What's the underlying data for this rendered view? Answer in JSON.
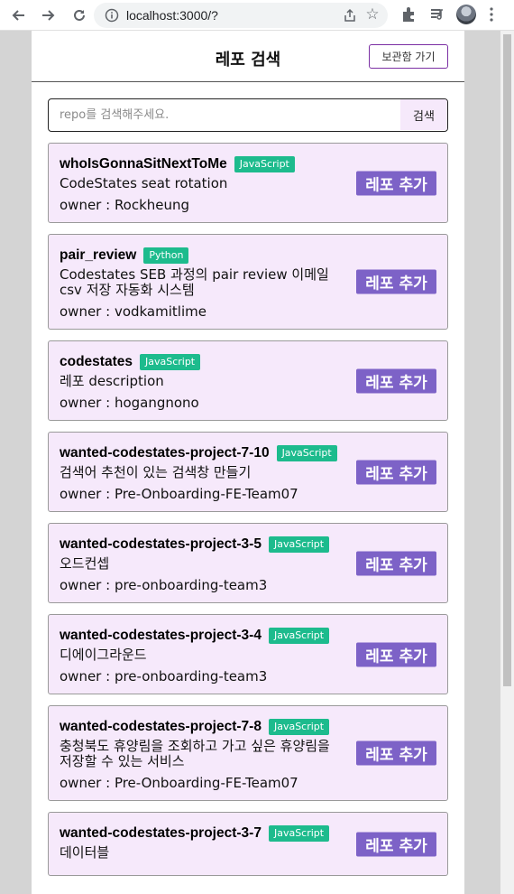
{
  "browser": {
    "url": "localhost:3000/?"
  },
  "header": {
    "title": "레포 검색",
    "box_button": "보관함 가기"
  },
  "search": {
    "placeholder": "repo를 검색해주세요.",
    "button": "검색"
  },
  "repos": [
    {
      "name": "whoIsGonnaSitNextToMe",
      "language": "JavaScript",
      "description": "CodeStates seat rotation",
      "owner": "owner : Rockheung",
      "add_label": "레포 추가"
    },
    {
      "name": "pair_review",
      "language": "Python",
      "description": "Codestates SEB 과정의 pair review 이메일 csv 저장 자동화 시스템",
      "owner": "owner : vodkamitlime",
      "add_label": "레포 추가"
    },
    {
      "name": "codestates",
      "language": "JavaScript",
      "description": "레포 description",
      "owner": "owner : hogangnono",
      "add_label": "레포 추가"
    },
    {
      "name": "wanted-codestates-project-7-10",
      "language": "JavaScript",
      "description": "검색어 추천이 있는 검색창 만들기",
      "owner": "owner : Pre-Onboarding-FE-Team07",
      "add_label": "레포 추가"
    },
    {
      "name": "wanted-codestates-project-3-5",
      "language": "JavaScript",
      "description": "오드컨셉",
      "owner": "owner : pre-onboarding-team3",
      "add_label": "레포 추가"
    },
    {
      "name": "wanted-codestates-project-3-4",
      "language": "JavaScript",
      "description": "디에이그라운드",
      "owner": "owner : pre-onboarding-team3",
      "add_label": "레포 추가"
    },
    {
      "name": "wanted-codestates-project-7-8",
      "language": "JavaScript",
      "description": "충청북도 휴양림을 조회하고 가고 싶은 휴양림을 저장할 수 있는 서비스",
      "owner": "owner : Pre-Onboarding-FE-Team07",
      "add_label": "레포 추가"
    },
    {
      "name": "wanted-codestates-project-3-7",
      "language": "JavaScript",
      "description": "데이터블",
      "owner": "",
      "add_label": "레포 추가"
    }
  ],
  "colors": {
    "card_bg": "#f6e9fb",
    "badge_bg": "#1dbb8d",
    "add_button_bg": "#7d62c7",
    "header_button_border": "#7b2fa3"
  }
}
